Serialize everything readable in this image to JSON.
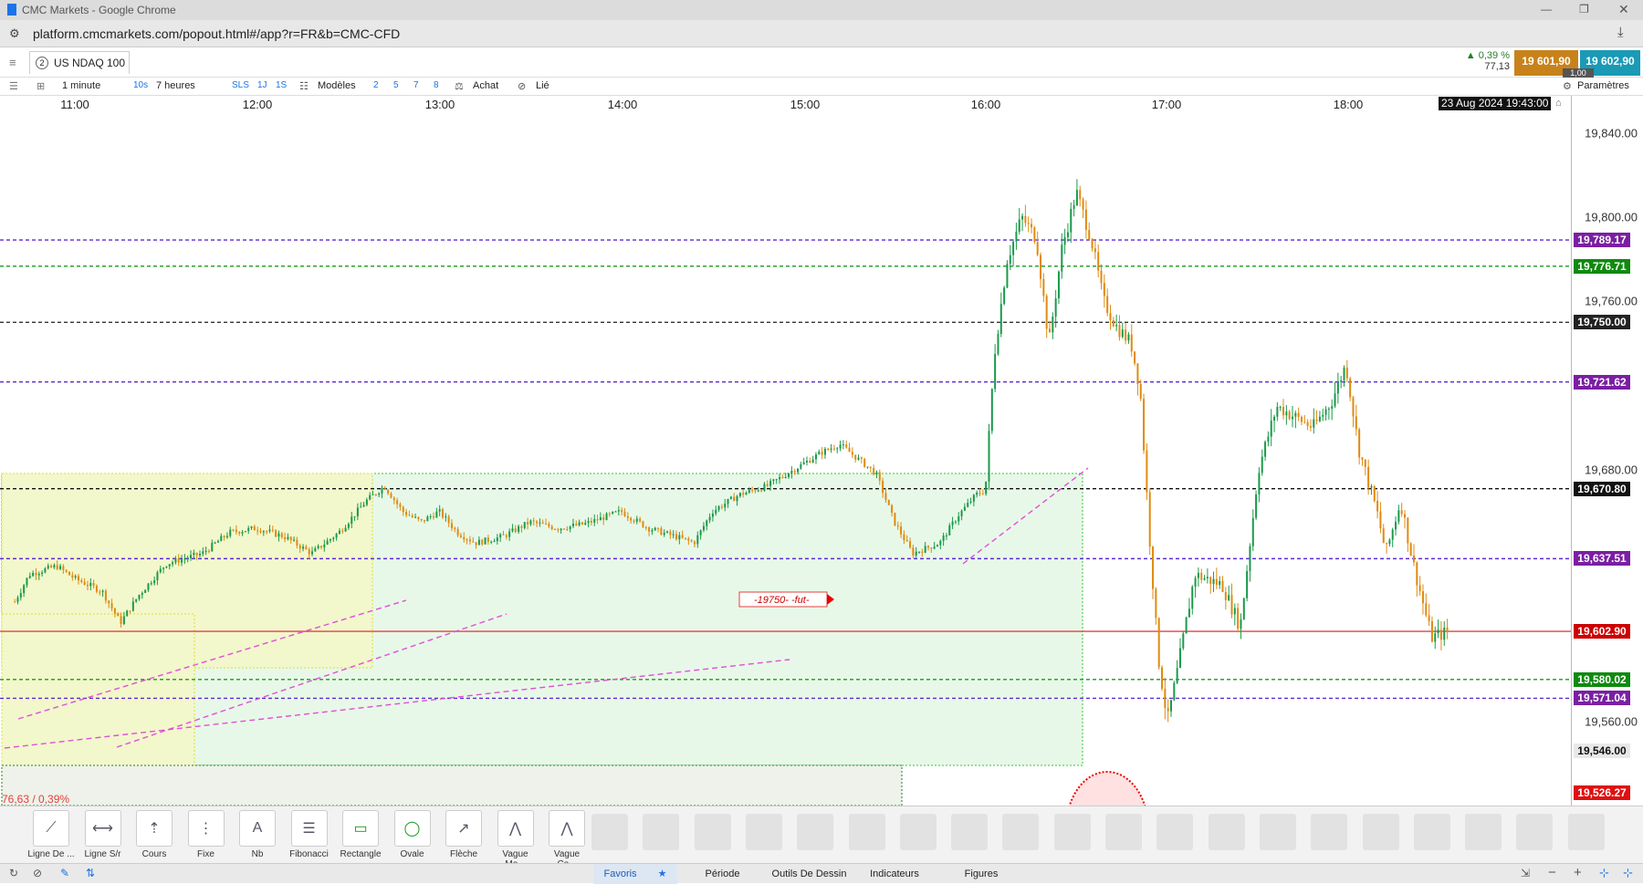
{
  "window": {
    "title": "CMC Markets - Google Chrome",
    "url": "platform.cmcmarkets.com/popout.html#/app?r=FR&b=CMC-CFD"
  },
  "instrument": {
    "number": "2",
    "name": "US NDAQ 100",
    "change_pct": "0,39 %",
    "change_pts": "77,13",
    "sell": "19 601,90",
    "buy": "19 602,90",
    "spread": "1,00"
  },
  "toolbar": {
    "interval": "1 minute",
    "period_btn": "10s",
    "range": "7 heures",
    "sls": "SLS",
    "one_j": "1J",
    "one_s": "1S",
    "templates": "Modèles",
    "nums": [
      "2",
      "5",
      "7",
      "8"
    ],
    "buy_label": "Achat",
    "linked": "Lié",
    "settings": "Paramètres"
  },
  "time_axis": {
    "ticks": [
      "11:00",
      "12:00",
      "13:00",
      "14:00",
      "15:00",
      "16:00",
      "17:00",
      "18:00"
    ],
    "crosshair_time": "23 Aug 2024 19:43:00"
  },
  "price_axis": {
    "ticks": [
      "19,840.00",
      "19,800.00",
      "19,760.00",
      "19,680.00",
      "19,560.00"
    ],
    "badges": [
      {
        "label": "19,789.17",
        "value": 19789.17,
        "color": "#7a1fa2"
      },
      {
        "label": "19,776.71",
        "value": 19776.71,
        "color": "#0f8a0f"
      },
      {
        "label": "19,750.00",
        "value": 19750.0,
        "color": "#222222"
      },
      {
        "label": "19,721.62",
        "value": 19721.62,
        "color": "#7a1fa2"
      },
      {
        "label": "19,670.80",
        "value": 19670.8,
        "color": "#111111"
      },
      {
        "label": "19,637.51",
        "value": 19637.51,
        "color": "#7a1fa2"
      },
      {
        "label": "19,602.90",
        "value": 19602.9,
        "color": "#cc0000"
      },
      {
        "label": "19,580.02",
        "value": 19580.02,
        "color": "#0f8a0f"
      },
      {
        "label": "19,571.04",
        "value": 19571.04,
        "color": "#7a1fa2"
      },
      {
        "label": "19,546.00",
        "value": 19546.0,
        "color": "#e8e8e8"
      },
      {
        "label": "19,526.27",
        "value": 19526.27,
        "color": "#e01010"
      }
    ]
  },
  "chart_data": {
    "type": "candlestick",
    "instrument": "US NDAQ 100",
    "interval": "1 minute",
    "x_ticks": [
      "11:00",
      "12:00",
      "13:00",
      "14:00",
      "15:00",
      "16:00",
      "17:00",
      "18:00"
    ],
    "ylim": [
      19520,
      19850
    ],
    "price_path": [
      [
        10.67,
        19617
      ],
      [
        10.75,
        19630
      ],
      [
        10.9,
        19634
      ],
      [
        11.0,
        19628
      ],
      [
        11.15,
        19622
      ],
      [
        11.25,
        19607
      ],
      [
        11.35,
        19620
      ],
      [
        11.5,
        19635
      ],
      [
        11.7,
        19640
      ],
      [
        11.85,
        19650
      ],
      [
        12.0,
        19652
      ],
      [
        12.15,
        19648
      ],
      [
        12.3,
        19640
      ],
      [
        12.45,
        19650
      ],
      [
        12.6,
        19665
      ],
      [
        12.7,
        19672
      ],
      [
        12.8,
        19660
      ],
      [
        12.9,
        19655
      ],
      [
        13.0,
        19660
      ],
      [
        13.1,
        19650
      ],
      [
        13.2,
        19645
      ],
      [
        13.35,
        19648
      ],
      [
        13.5,
        19655
      ],
      [
        13.65,
        19652
      ],
      [
        13.8,
        19654
      ],
      [
        14.0,
        19660
      ],
      [
        14.15,
        19652
      ],
      [
        14.3,
        19648
      ],
      [
        14.4,
        19645
      ],
      [
        14.5,
        19660
      ],
      [
        14.65,
        19668
      ],
      [
        14.8,
        19672
      ],
      [
        14.95,
        19680
      ],
      [
        15.1,
        19688
      ],
      [
        15.2,
        19692
      ],
      [
        15.3,
        19685
      ],
      [
        15.4,
        19678
      ],
      [
        15.5,
        19655
      ],
      [
        15.6,
        19640
      ],
      [
        15.75,
        19645
      ],
      [
        15.85,
        19658
      ],
      [
        15.95,
        19668
      ],
      [
        16.0,
        19670
      ],
      [
        16.05,
        19735
      ],
      [
        16.12,
        19780
      ],
      [
        16.2,
        19800
      ],
      [
        16.28,
        19790
      ],
      [
        16.35,
        19740
      ],
      [
        16.42,
        19785
      ],
      [
        16.5,
        19812
      ],
      [
        16.58,
        19790
      ],
      [
        16.65,
        19760
      ],
      [
        16.72,
        19748
      ],
      [
        16.8,
        19740
      ],
      [
        16.85,
        19718
      ],
      [
        16.9,
        19650
      ],
      [
        16.95,
        19590
      ],
      [
        17.0,
        19560
      ],
      [
        17.05,
        19582
      ],
      [
        17.15,
        19630
      ],
      [
        17.3,
        19625
      ],
      [
        17.4,
        19605
      ],
      [
        17.5,
        19680
      ],
      [
        17.6,
        19710
      ],
      [
        17.7,
        19705
      ],
      [
        17.8,
        19700
      ],
      [
        17.9,
        19712
      ],
      [
        17.98,
        19730
      ],
      [
        18.05,
        19690
      ],
      [
        18.15,
        19660
      ],
      [
        18.2,
        19640
      ],
      [
        18.28,
        19665
      ],
      [
        18.35,
        19635
      ],
      [
        18.45,
        19600
      ],
      [
        18.55,
        19603
      ]
    ],
    "levels": [
      {
        "value": 19789.17,
        "style": "dashed",
        "color": "#5a2bcf"
      },
      {
        "value": 19776.71,
        "style": "dashed",
        "color": "#1a9a1a"
      },
      {
        "value": 19750.0,
        "style": "dashed",
        "color": "#333333"
      },
      {
        "value": 19721.62,
        "style": "dashed",
        "color": "#5a2bcf"
      },
      {
        "value": 19670.8,
        "style": "dashed",
        "color": "#111111"
      },
      {
        "value": 19637.51,
        "style": "dashed",
        "color": "#5a2bcf"
      },
      {
        "value": 19602.9,
        "style": "solid",
        "color": "#d44"
      },
      {
        "value": 19580.02,
        "style": "dashed",
        "color": "#1a9a1a"
      },
      {
        "value": 19571.04,
        "style": "dashed",
        "color": "#5a2bcf"
      }
    ],
    "annotations": {
      "label_19750": "-19750- -fut-",
      "bottom_left": "76,63 / 0,39%"
    }
  },
  "drawing_tools": [
    {
      "label": "Ligne De ...",
      "icon": "trend-line-icon"
    },
    {
      "label": "Ligne S/r",
      "icon": "sr-line-icon"
    },
    {
      "label": "Cours",
      "icon": "price-icon"
    },
    {
      "label": "Fixe",
      "icon": "fixed-icon"
    },
    {
      "label": "Nb",
      "icon": "text-icon"
    },
    {
      "label": "Fibonacci",
      "icon": "fibonacci-icon"
    },
    {
      "label": "Rectangle",
      "icon": "rectangle-icon"
    },
    {
      "label": "Ovale",
      "icon": "oval-icon"
    },
    {
      "label": "Flèche",
      "icon": "arrow-icon"
    },
    {
      "label": "Vague Mo...",
      "icon": "wave-icon"
    },
    {
      "label": "Vague Co...",
      "icon": "wave2-icon"
    }
  ],
  "bottom_tabs": [
    "Favoris",
    "Période",
    "Outils De Dessin",
    "Indicateurs",
    "Figures"
  ]
}
